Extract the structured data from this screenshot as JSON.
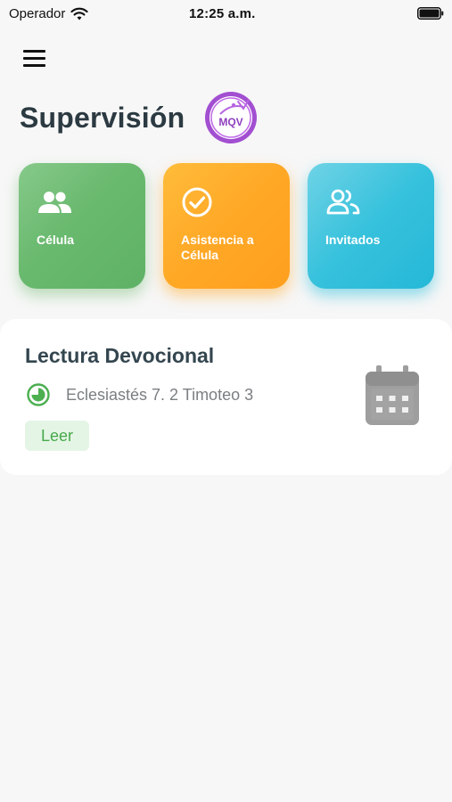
{
  "status_bar": {
    "carrier": "Operador",
    "time": "12:25 a.m."
  },
  "header": {
    "title": "Supervisión",
    "logo_text": "MQV"
  },
  "actions": [
    {
      "label": "Célula",
      "icon": "group-icon",
      "color": "#6bb96f"
    },
    {
      "label": "Asistencia a Célula",
      "icon": "check-circle-icon",
      "color": "#ffa826"
    },
    {
      "label": "Invitados",
      "icon": "people-outline-icon",
      "color": "#36c1dc"
    }
  ],
  "devotional": {
    "title": "Lectura Devocional",
    "reading": "Eclesiastés 7. 2 Timoteo 3",
    "button_label": "Leer",
    "accent_color": "#4caf50"
  }
}
